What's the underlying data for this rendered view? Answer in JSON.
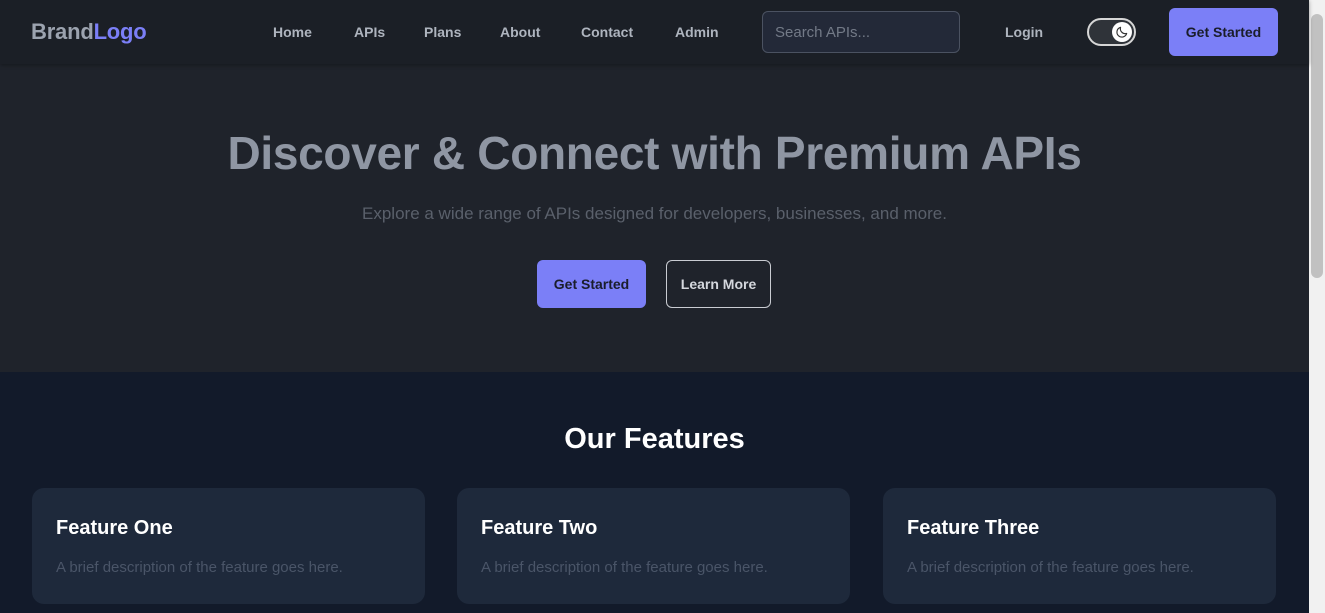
{
  "navbar": {
    "brand_part1": "Brand",
    "brand_part2": "Logo",
    "links": [
      "Home",
      "APIs",
      "Plans",
      "About",
      "Contact",
      "Admin"
    ],
    "search_placeholder": "Search APIs...",
    "login_label": "Login",
    "theme_toggle_icon": "moon-icon",
    "cta_label": "Get Started"
  },
  "hero": {
    "title": "Discover & Connect with Premium APIs",
    "subtitle": "Explore a wide range of APIs designed for developers, businesses, and more.",
    "primary_button": "Get Started",
    "secondary_button": "Learn More"
  },
  "features": {
    "title": "Our Features",
    "cards": [
      {
        "title": "Feature One",
        "description": "A brief description of the feature goes here."
      },
      {
        "title": "Feature Two",
        "description": "A brief description of the feature goes here."
      },
      {
        "title": "Feature Three",
        "description": "A brief description of the feature goes here."
      }
    ]
  },
  "colors": {
    "accent": "#7b7ff7",
    "nav_bg": "#1b1f26",
    "hero_bg": "#1f232b",
    "features_bg": "#121a2a",
    "card_bg": "#1e293b"
  }
}
